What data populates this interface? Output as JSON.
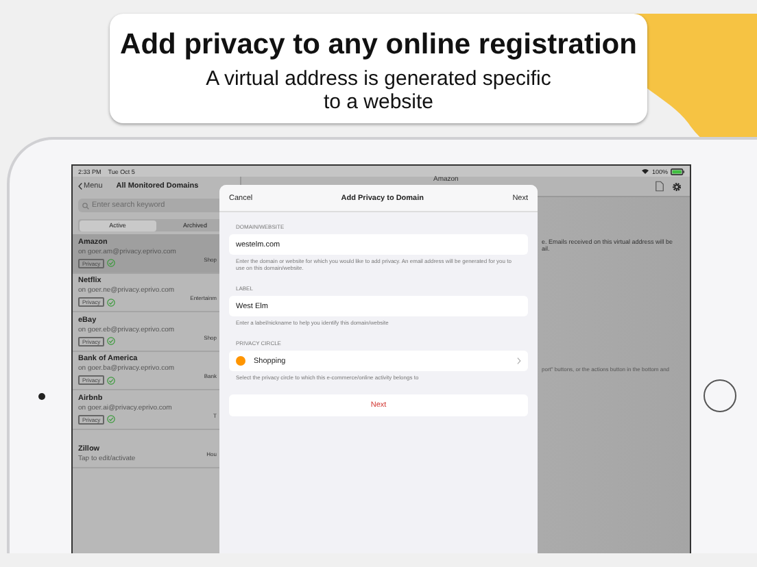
{
  "header": {
    "title": "Add privacy to any online registration",
    "subtitle": "A virtual address is generated specific to a website"
  },
  "status_bar": {
    "time": "2:33 PM",
    "date": "Tue Oct 5",
    "battery": "100%"
  },
  "sidebar": {
    "back": "Menu",
    "title": "All Monitored Domains",
    "search": {
      "placeholder": "Enter search keyword"
    },
    "segments": [
      {
        "label": "Active",
        "selected": true
      },
      {
        "label": "Archived",
        "selected": false
      }
    ],
    "items": [
      {
        "name": "Amazon",
        "detail": "on goer.am@privacy.eprivo.com",
        "tag": "Privacy",
        "category": "Shop",
        "selected": true
      },
      {
        "name": "Netflix",
        "detail": "on goer.ne@privacy.eprivo.com",
        "tag": "Privacy",
        "category": "Entertainm",
        "selected": false
      },
      {
        "name": "eBay",
        "detail": "on goer.eb@privacy.eprivo.com",
        "tag": "Privacy",
        "category": "Shop",
        "selected": false
      },
      {
        "name": "Bank of America",
        "detail": "on goer.ba@privacy.eprivo.com",
        "tag": "Privacy",
        "category": "Bank",
        "selected": false
      },
      {
        "name": "Airbnb",
        "detail": "on goer.ai@privacy.eprivo.com",
        "tag": "Privacy",
        "category": "T",
        "selected": false
      },
      {
        "name": "Zillow",
        "detail": "Tap to edit/activate",
        "category": "Hou",
        "selected": false
      }
    ]
  },
  "detail": {
    "title": "Amazon",
    "texts": [
      "e. Emails received on this virtual address will be",
      "ail.",
      "port\" buttons, or the actions button in the bottom and"
    ]
  },
  "modal": {
    "cancel": "Cancel",
    "title": "Add Privacy to Domain",
    "next": "Next",
    "sections": [
      {
        "kind": "field",
        "header": "DOMAIN/WEBSITE",
        "value": "westelm.com",
        "footer": "Enter the domain or website for which you would like to add privacy. An email address will be generated for you to use on this domain/website."
      },
      {
        "kind": "field",
        "header": "LABEL",
        "value": "West Elm",
        "footer": "Enter a label/nickname to help you identify this domain/website"
      },
      {
        "kind": "picker",
        "header": "PRIVACY CIRCLE",
        "value": "Shopping",
        "color": "#ff9500",
        "footer": "Select the privacy circle to which this e-commerce/online activity belongs to"
      }
    ],
    "button": "Next"
  }
}
